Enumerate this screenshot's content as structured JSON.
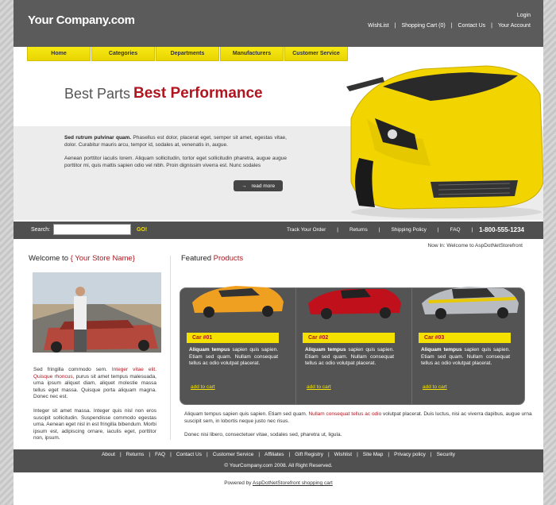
{
  "header": {
    "logo": "Your Company.com",
    "login": "Login",
    "links": [
      "WishList",
      "Shopping Cart (0)",
      "Contact Us",
      "Your Account"
    ]
  },
  "nav": {
    "tabs": [
      "Home",
      "Categories",
      "Departments",
      "Manufacturers",
      "Customer Service"
    ]
  },
  "hero": {
    "tagline_part1": "Best Parts",
    "tagline_part2": "Best Performance",
    "para1_bold": "Sed rutrum pulvinar quam.",
    "para1_rest": " Phasellus est dolor, placerat eget, semper sit amet, egestas vitae, dolor. Curabitur mauris arcu, tempor id, sodales at, venenatis in, augue.",
    "para2": "Aenean porttitor iaculis lorem. Aliquam sollicitudin, tortor eget sollicitudin pharetra, augue augue porttitor mi, quis mattis sapien odio vel nibh. Proin dignissim viverra est. Nunc sodales",
    "read_more": "read more",
    "car_color": "#f2d400"
  },
  "search": {
    "label": "Search:",
    "value": "",
    "go": "GO!",
    "links": [
      "Track Your Order",
      "Returns",
      "Shipping Policy",
      "FAQ"
    ],
    "phone": "1-800-555-1234"
  },
  "now_in": "Now In: Welcome to AspDotNetStorefront",
  "welcome": {
    "title_prefix": "Welcome to",
    "title_store": "{ Your Store Name}",
    "p1_start": "Sed fringilla commodo sem. ",
    "p1_red": "Integer vitae elit. Quisque rhoncus,",
    "p1_end": " purus sit amet tempus malesuada, urna ipsum aliquet diam, aliquet molestie massa tellus eget massa. Quisque porta aliquam magna. Donec nec est.",
    "p2": "Integer sit amet massa. Integer quis nisl non eros suscipit sollicitudin. Suspendisse commodo egestas urna. Aenean eget nisl in est fringilla bibendum. Morbi ipsum est, adipiscing ornare, iaculis eget, porttitor non, ipsum."
  },
  "featured": {
    "title_prefix": "Featured",
    "title_red": "Products",
    "products": [
      {
        "name": "Car #01",
        "desc_bold": "Aliquam tempus",
        "desc": " sapien quis sapien. Etiam sed quam. Nullam consequat tellus ac odio volutpat placerat.",
        "cart": "add to cart",
        "color": "#f0a020"
      },
      {
        "name": "Car #02",
        "desc_bold": "Aliquam tempus",
        "desc": " sapien quis sapien. Etiam sed quam. Nullam consequat tellus ac odio volutpat placerat.",
        "cart": "add to cart",
        "color": "#c0101c"
      },
      {
        "name": "Car #03",
        "desc_bold": "Aliquam tempus",
        "desc": " sapien quis sapien. Etiam sed quam. Nullam consequat tellus ac odio volutpat placerat.",
        "cart": "add to cart",
        "color": "#b8bcc0"
      }
    ],
    "p1_start": "Aliquam tempus sapien quis sapien. Etiam sed quam. ",
    "p1_red": "Nullam consequat tellus ac odio",
    "p1_end": " volutpat placerat. Duis luctus, nisi ac viverra dapibus, augue urna suscipit sem, in lobortis neque justo nec risus.",
    "p2": "Donec nisi libero, consectetuer vitae, sodales sed, pharetra ut, ligula."
  },
  "footer": {
    "links": [
      "About",
      "Returns",
      "FAQ",
      "Contact Us",
      "Customer Service",
      "Affiliates",
      "Gift Registry",
      "Wishlist",
      "Site Map",
      "Privacy policy",
      "Security"
    ],
    "copyright": "© YourCompany.com 2008. All Right Reserved.",
    "powered_prefix": "Powered by ",
    "powered_link": "AspDotNetStorefront shopping cart"
  }
}
